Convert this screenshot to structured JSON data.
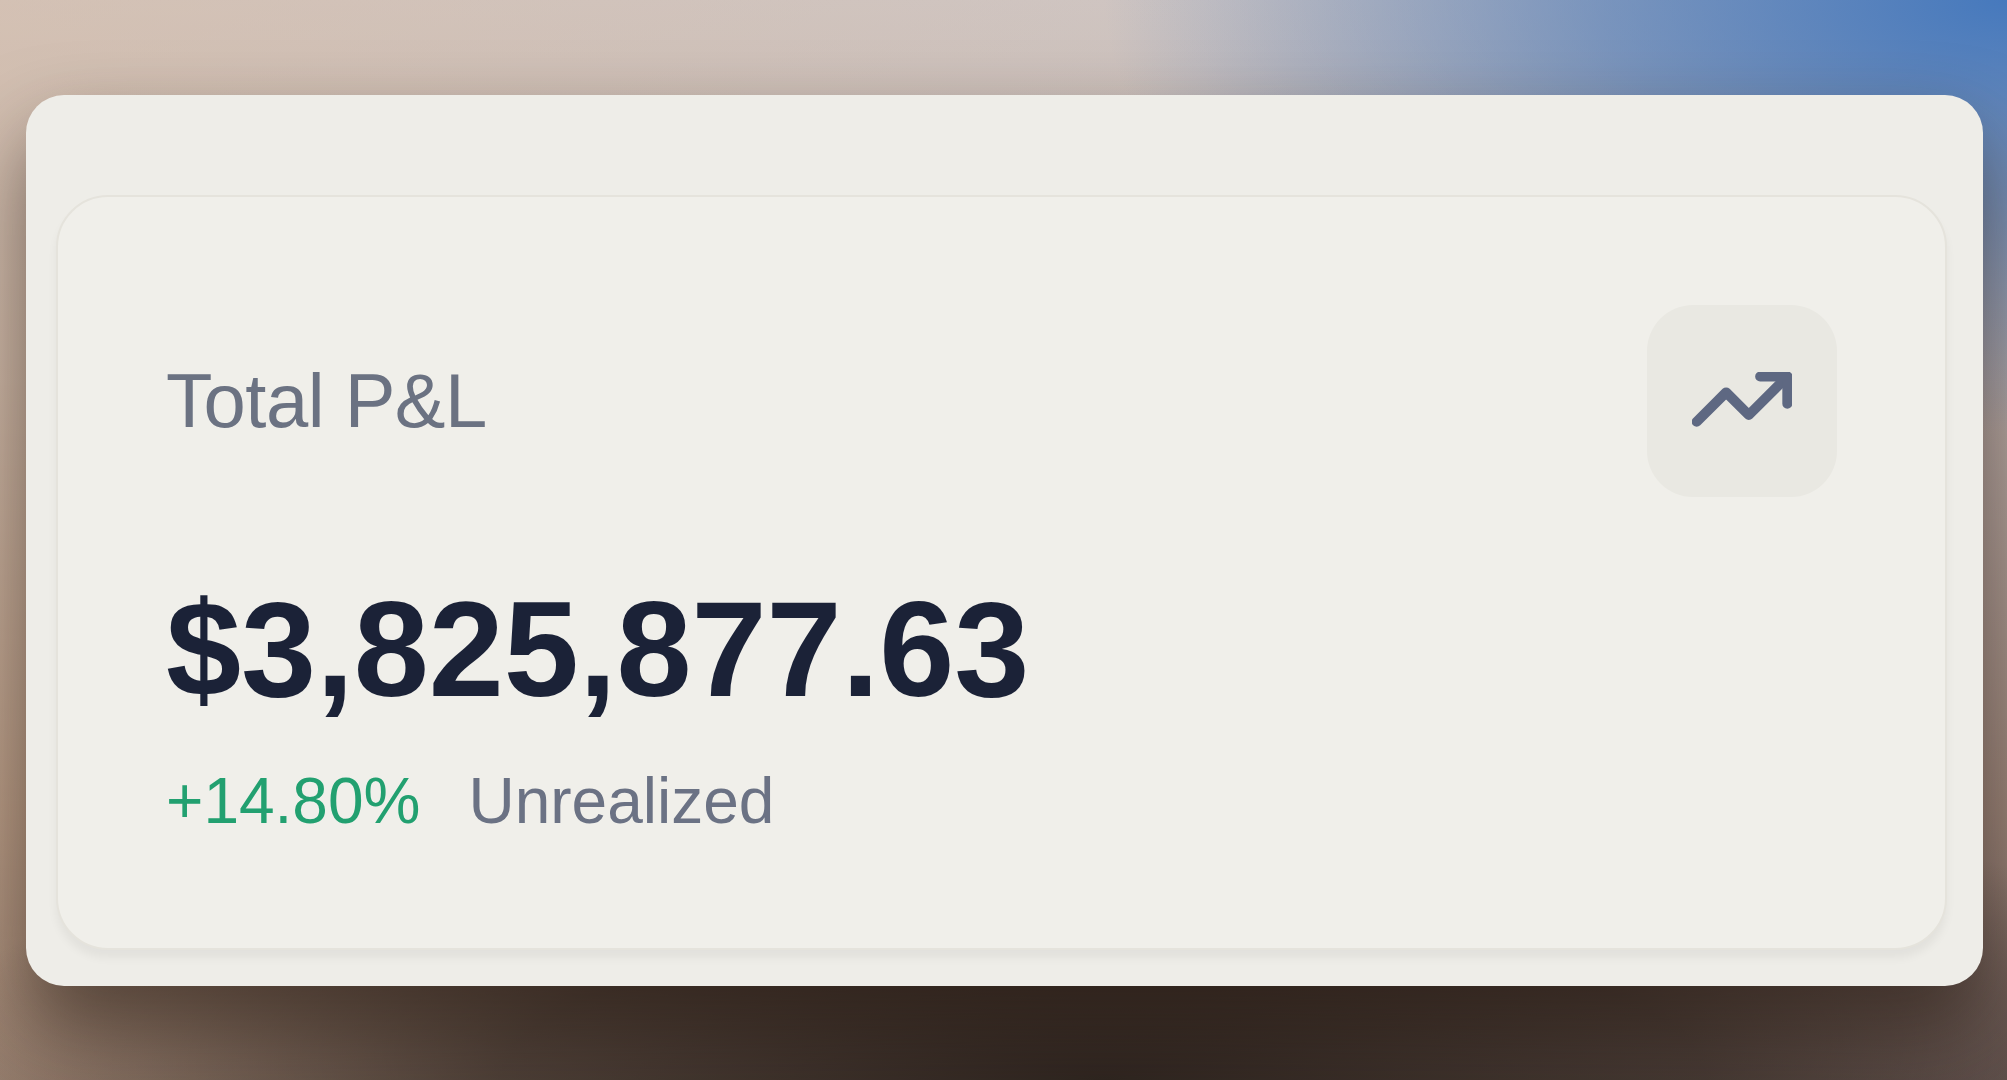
{
  "card": {
    "title": "Total P&L",
    "value": "$3,825,877.63",
    "change": "+14.80%",
    "change_positive": true,
    "caption": "Unrealized"
  }
}
